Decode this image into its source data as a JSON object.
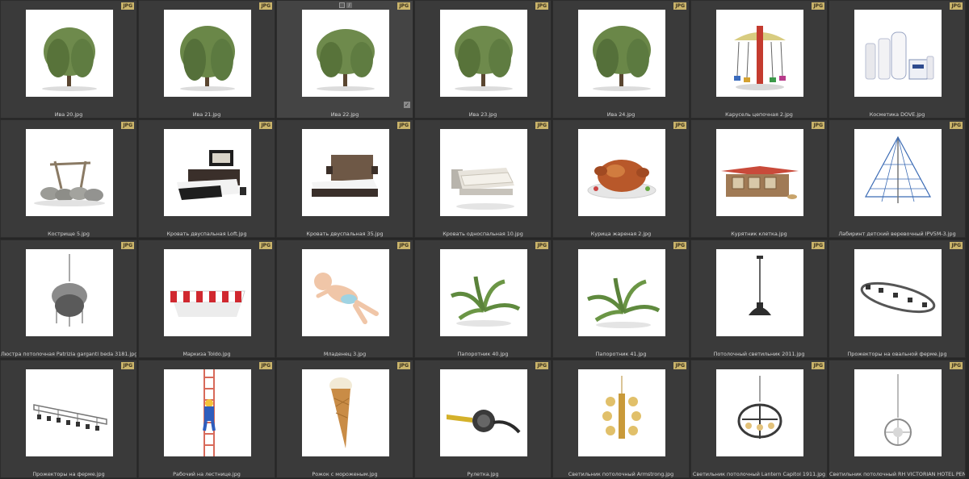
{
  "badge_label": "JPG",
  "items": [
    {
      "caption": "Ива 20.jpg",
      "icon": "willow-tree-icon"
    },
    {
      "caption": "Ива 21.jpg",
      "icon": "willow-tree-icon"
    },
    {
      "caption": "Ива 22.jpg",
      "icon": "willow-tree-icon"
    },
    {
      "caption": "Ива 23.jpg",
      "icon": "willow-tree-icon"
    },
    {
      "caption": "Ива 24.jpg",
      "icon": "willow-tree-icon"
    },
    {
      "caption": "Карусель цепочная 2.jpg",
      "icon": "carousel-icon"
    },
    {
      "caption": "Косметика DOVE.jpg",
      "icon": "cosmetics-bottles-icon"
    },
    {
      "caption": "Кострище 5.jpg",
      "icon": "campfire-stones-icon"
    },
    {
      "caption": "Кровать двуспальная Loft.jpg",
      "icon": "double-bed-icon"
    },
    {
      "caption": "Кровать двуспальная 35.jpg",
      "icon": "double-bed-icon"
    },
    {
      "caption": "Кровать односпальная 10.jpg",
      "icon": "single-bed-icon"
    },
    {
      "caption": "Курица жареная 2.jpg",
      "icon": "roast-chicken-icon"
    },
    {
      "caption": "Курятник клетка.jpg",
      "icon": "chicken-coop-icon"
    },
    {
      "caption": "Лабиринт детский веревочный IPV5M-3.jpg",
      "icon": "rope-pyramid-icon"
    },
    {
      "caption": "Люстра потолочная Patrizia garganti beda 3181.jpg",
      "icon": "chandelier-icon"
    },
    {
      "caption": "Маркиза Toldo.jpg",
      "icon": "striped-awning-icon"
    },
    {
      "caption": "Младенец 3.jpg",
      "icon": "baby-icon"
    },
    {
      "caption": "Папоротник 40.jpg",
      "icon": "fern-icon"
    },
    {
      "caption": "Папоротник 41.jpg",
      "icon": "fern-icon"
    },
    {
      "caption": "Потолочный светильник 2011.jpg",
      "icon": "pendant-lamp-icon"
    },
    {
      "caption": "Прожекторы на овальной ферме.jpg",
      "icon": "oval-truss-icon"
    },
    {
      "caption": "Прожекторы на ферме.jpg",
      "icon": "light-truss-icon"
    },
    {
      "caption": "Рабочий на лестнице.jpg",
      "icon": "worker-ladder-icon"
    },
    {
      "caption": "Рожок с мороженым.jpg",
      "icon": "ice-cream-cone-icon"
    },
    {
      "caption": "Рулетка.jpg",
      "icon": "tape-measure-icon"
    },
    {
      "caption": "Светильник потолочный Armstrong.jpg",
      "icon": "brass-chandelier-icon"
    },
    {
      "caption": "Светильник потолочный Lantern Capitol 1911.jpg",
      "icon": "lantern-chandelier-icon"
    },
    {
      "caption": "Светильник потолочный RH VICTORIAN HOTEL PENDAN...",
      "icon": "crystal-pendant-icon"
    }
  ]
}
